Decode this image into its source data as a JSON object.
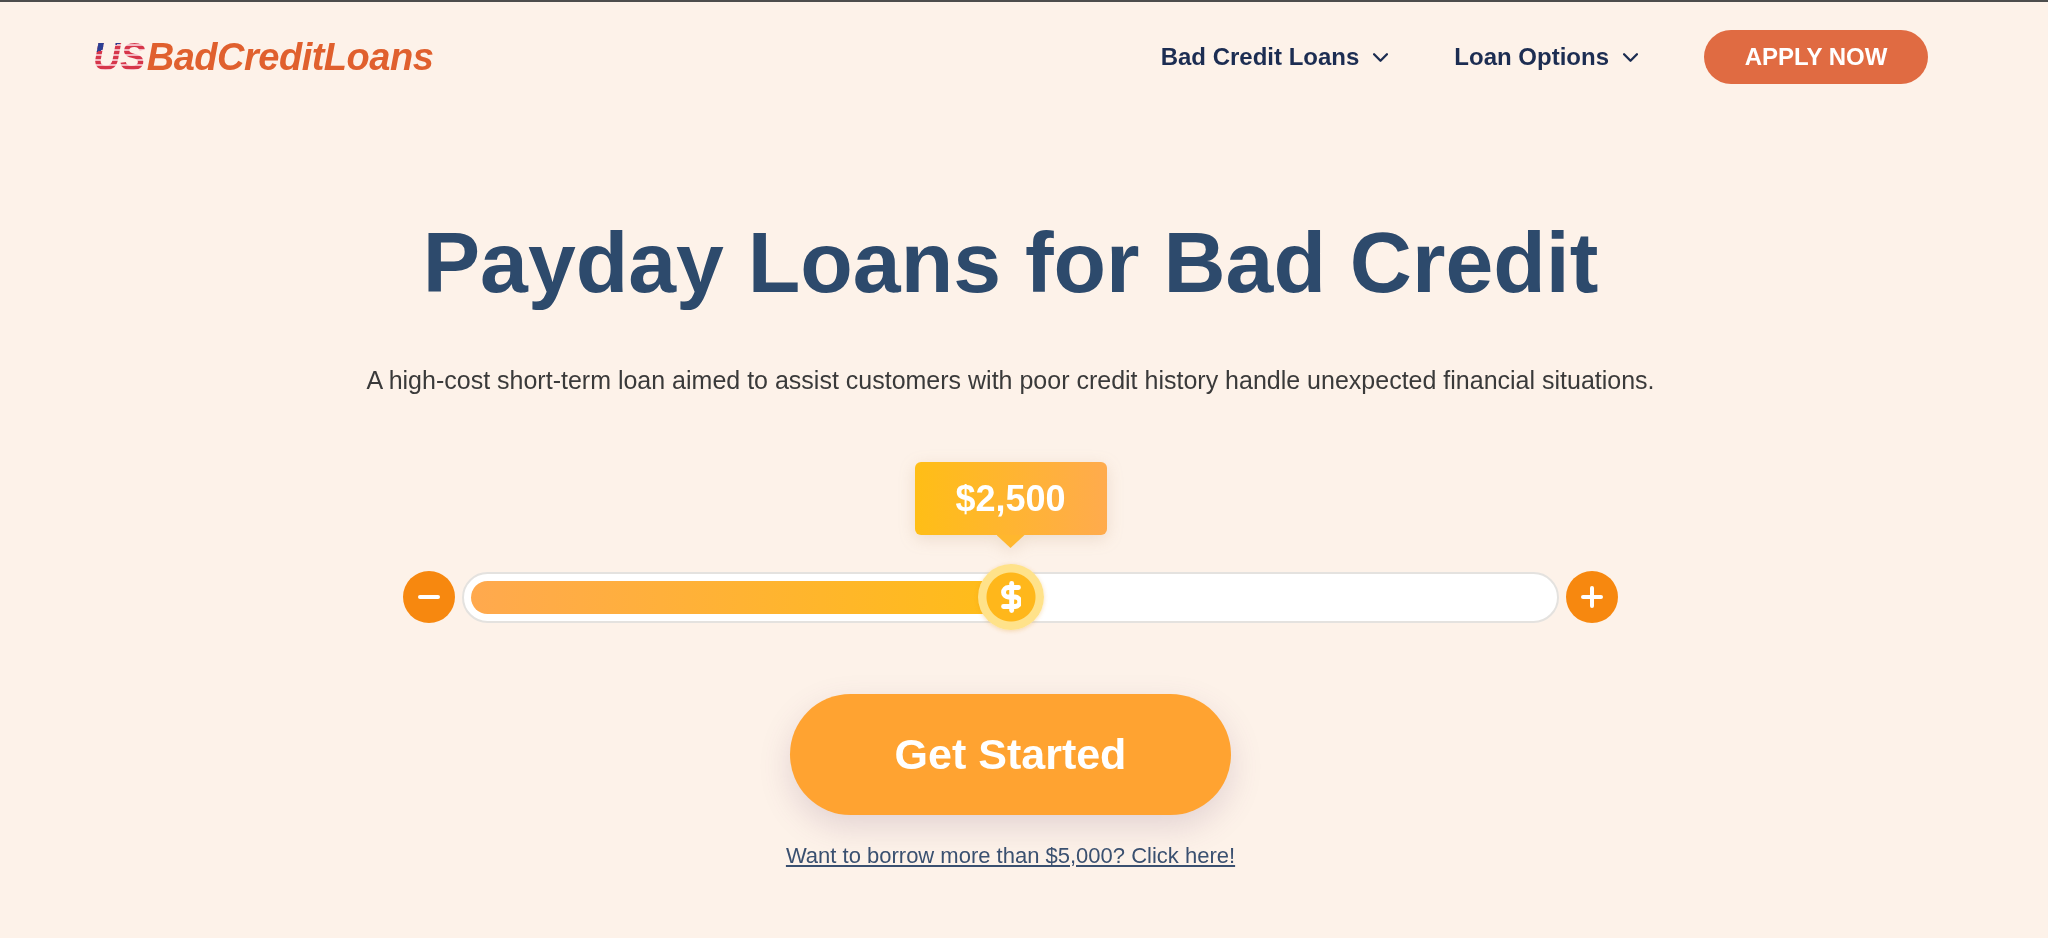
{
  "logo": {
    "flag_part": "US",
    "text": "BadCreditLoans"
  },
  "nav": {
    "items": [
      {
        "label": "Bad Credit Loans",
        "dropdown": true
      },
      {
        "label": "Loan Options",
        "dropdown": true
      }
    ],
    "cta": "APPLY NOW"
  },
  "hero": {
    "title": "Payday Loans for Bad Credit",
    "subtitle": "A high-cost short-term loan aimed to assist customers with poor credit history handle unexpected financial situations.",
    "loan_slider": {
      "amount": "$2,500",
      "level": 0.5
    },
    "button": "Get Started",
    "link": "Want to borrow more than $5,000? Click here!"
  }
}
